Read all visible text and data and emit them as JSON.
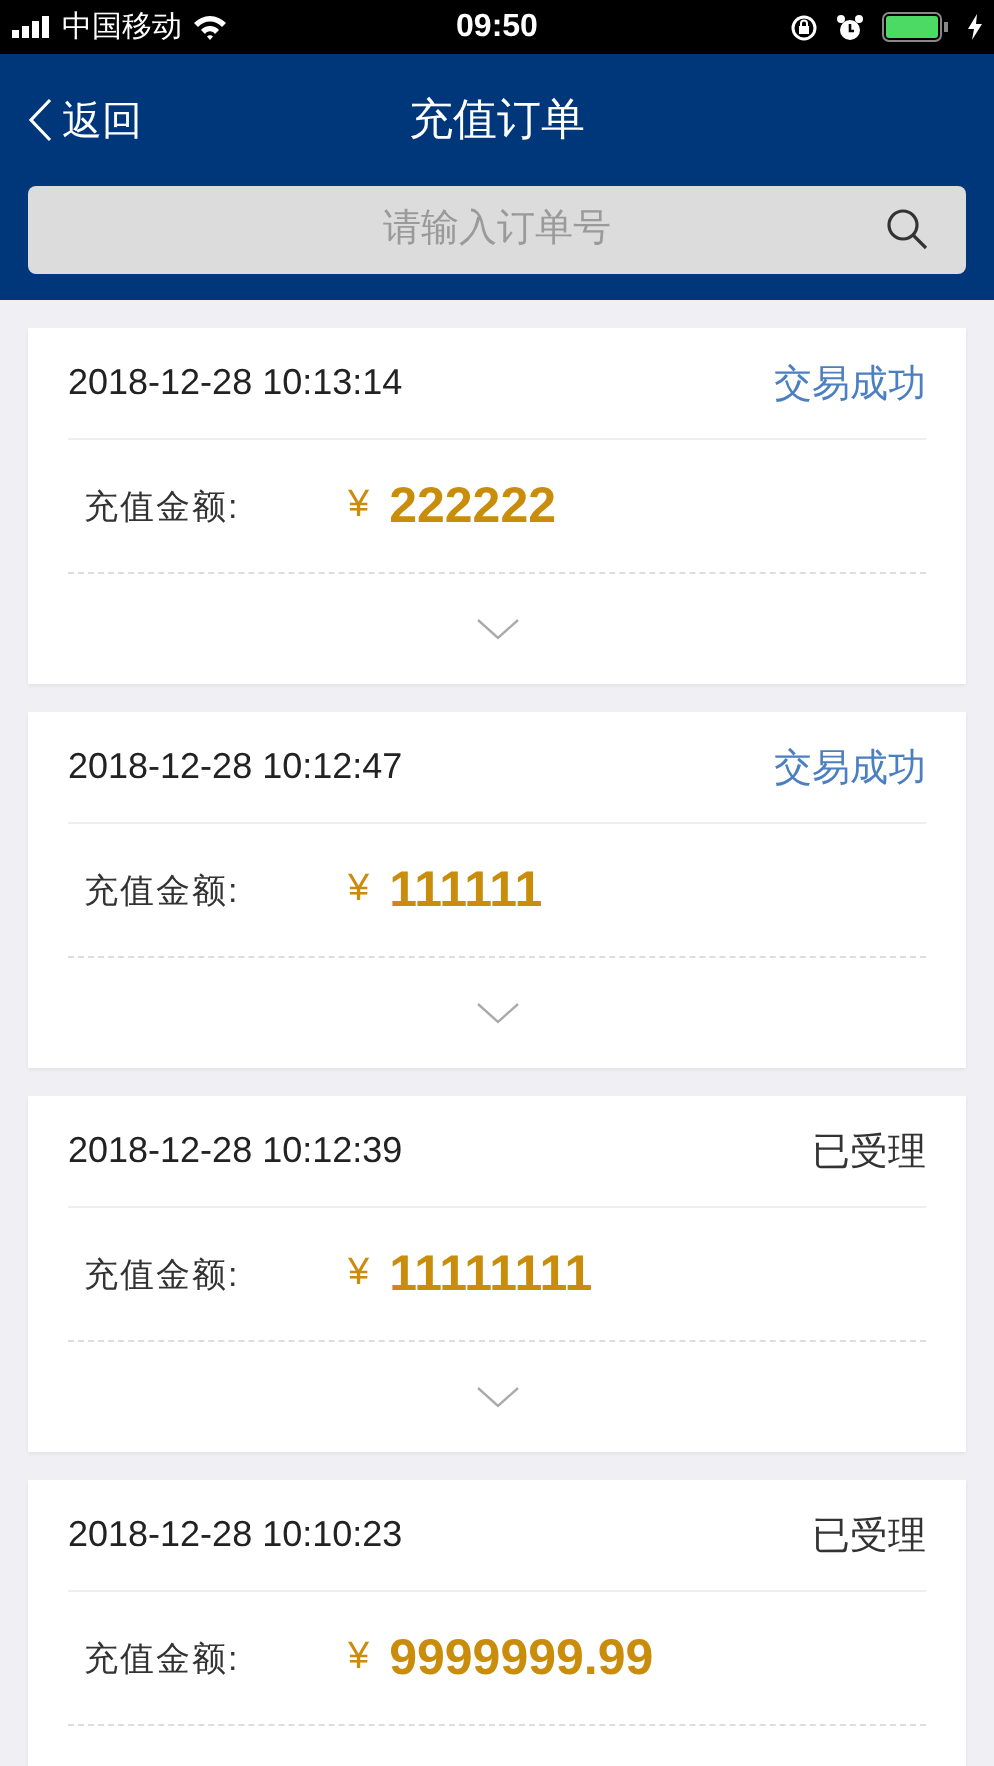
{
  "status_bar": {
    "carrier": "中国移动",
    "time": "09:50"
  },
  "nav": {
    "back": "返回",
    "title": "充值订单"
  },
  "search": {
    "placeholder": "请输入订单号"
  },
  "orders": [
    {
      "time": "2018-12-28 10:13:14",
      "status": "交易成功",
      "success": true,
      "label": "充值金额:",
      "currency": "¥",
      "amount": "222222"
    },
    {
      "time": "2018-12-28 10:12:47",
      "status": "交易成功",
      "success": true,
      "label": "充值金额:",
      "currency": "¥",
      "amount": "111111"
    },
    {
      "time": "2018-12-28 10:12:39",
      "status": "已受理",
      "success": false,
      "label": "充值金额:",
      "currency": "¥",
      "amount": "11111111"
    },
    {
      "time": "2018-12-28 10:10:23",
      "status": "已受理",
      "success": false,
      "label": "充值金额:",
      "currency": "¥",
      "amount": "9999999.99"
    }
  ]
}
